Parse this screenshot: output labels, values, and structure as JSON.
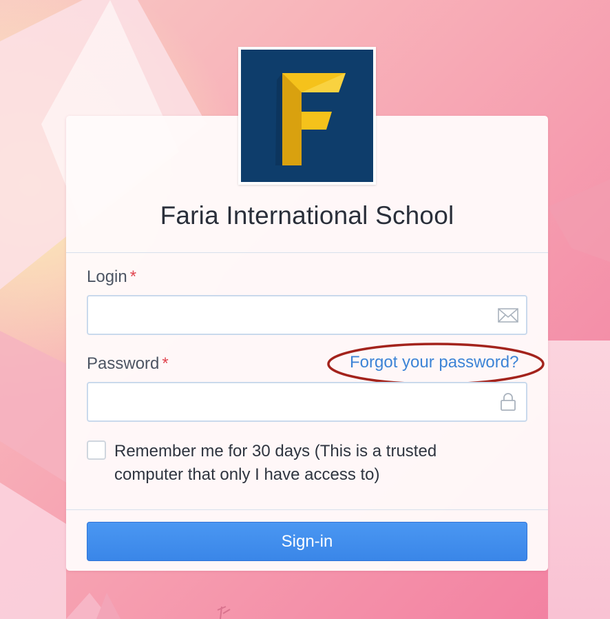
{
  "school": {
    "name": "Faria International School",
    "logo_letter": "F",
    "logo_bg": "#0e3d6b",
    "logo_fg": "#f5c21b"
  },
  "form": {
    "login": {
      "label": "Login",
      "required_mark": "*",
      "value": "",
      "placeholder": "",
      "icon": "envelope-icon"
    },
    "password": {
      "label": "Password",
      "required_mark": "*",
      "value": "",
      "placeholder": "",
      "icon": "lock-icon",
      "forgot_link": "Forgot your password?"
    },
    "remember": {
      "checked": false,
      "label": "Remember me for 30 days (This is a trusted computer that only I have access to)"
    },
    "submit_label": "Sign-in"
  },
  "colors": {
    "accent": "#3a86e8",
    "link": "#3d84d6",
    "required": "#e0444f",
    "annotation": "#a3231c"
  }
}
